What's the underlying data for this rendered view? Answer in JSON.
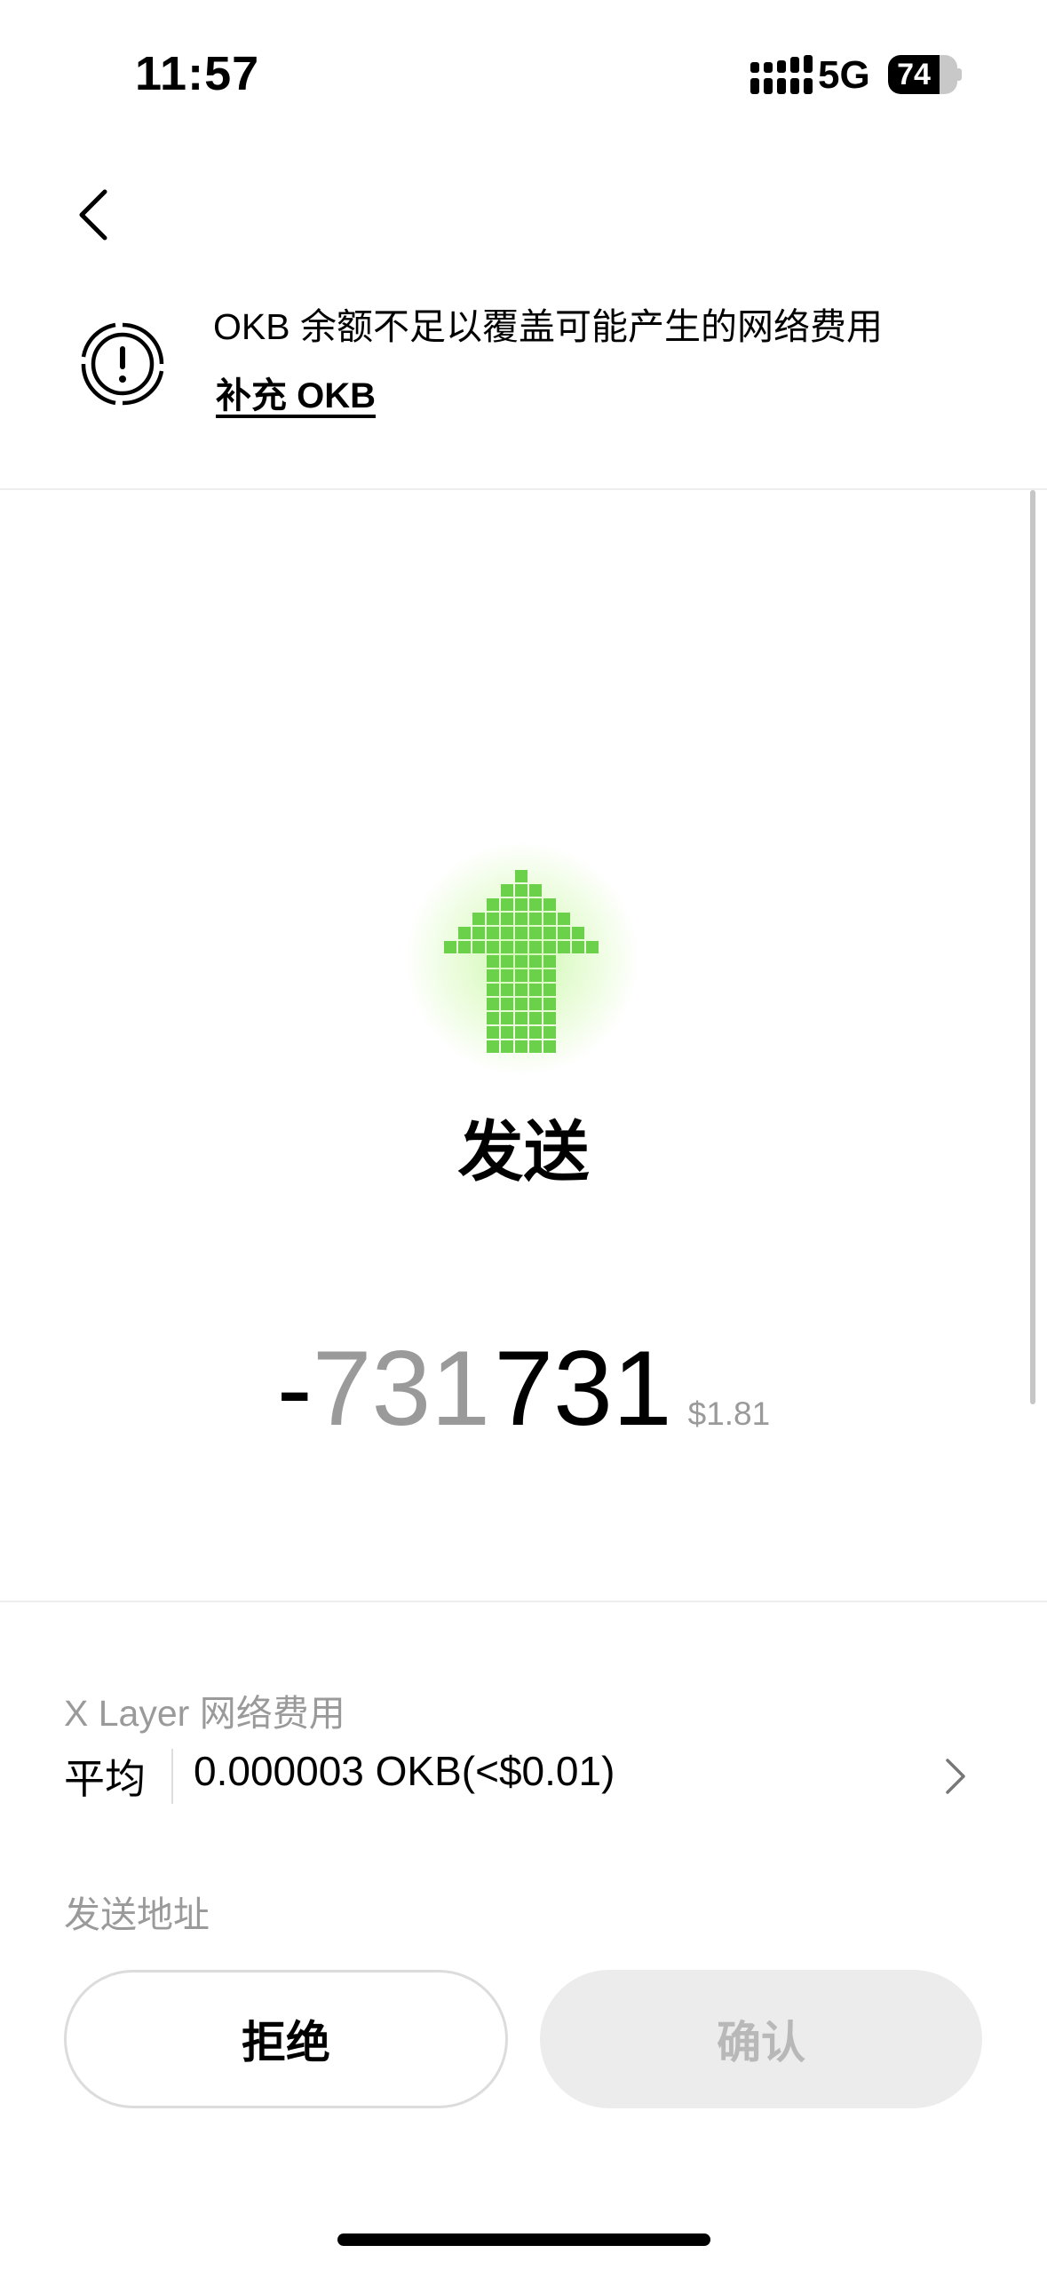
{
  "status_bar": {
    "time": "11:57",
    "network": "5G",
    "battery": "74",
    "battery_level": 0.74
  },
  "warning": {
    "message": "OKB 余额不足以覆盖可能产生的网络费用",
    "link": "补充 OKB"
  },
  "transaction": {
    "action": "发送",
    "amount_minus": "-",
    "amount_dim": "731",
    "amount_strong": "731",
    "amount_usd": "$1.81",
    "accent_color": "#6bd04a"
  },
  "fee": {
    "label": "X Layer 网络费用",
    "speed": "平均",
    "value": "0.000003 OKB(<$0.01)"
  },
  "address": {
    "label": "发送地址"
  },
  "buttons": {
    "reject": "拒绝",
    "confirm": "确认"
  }
}
